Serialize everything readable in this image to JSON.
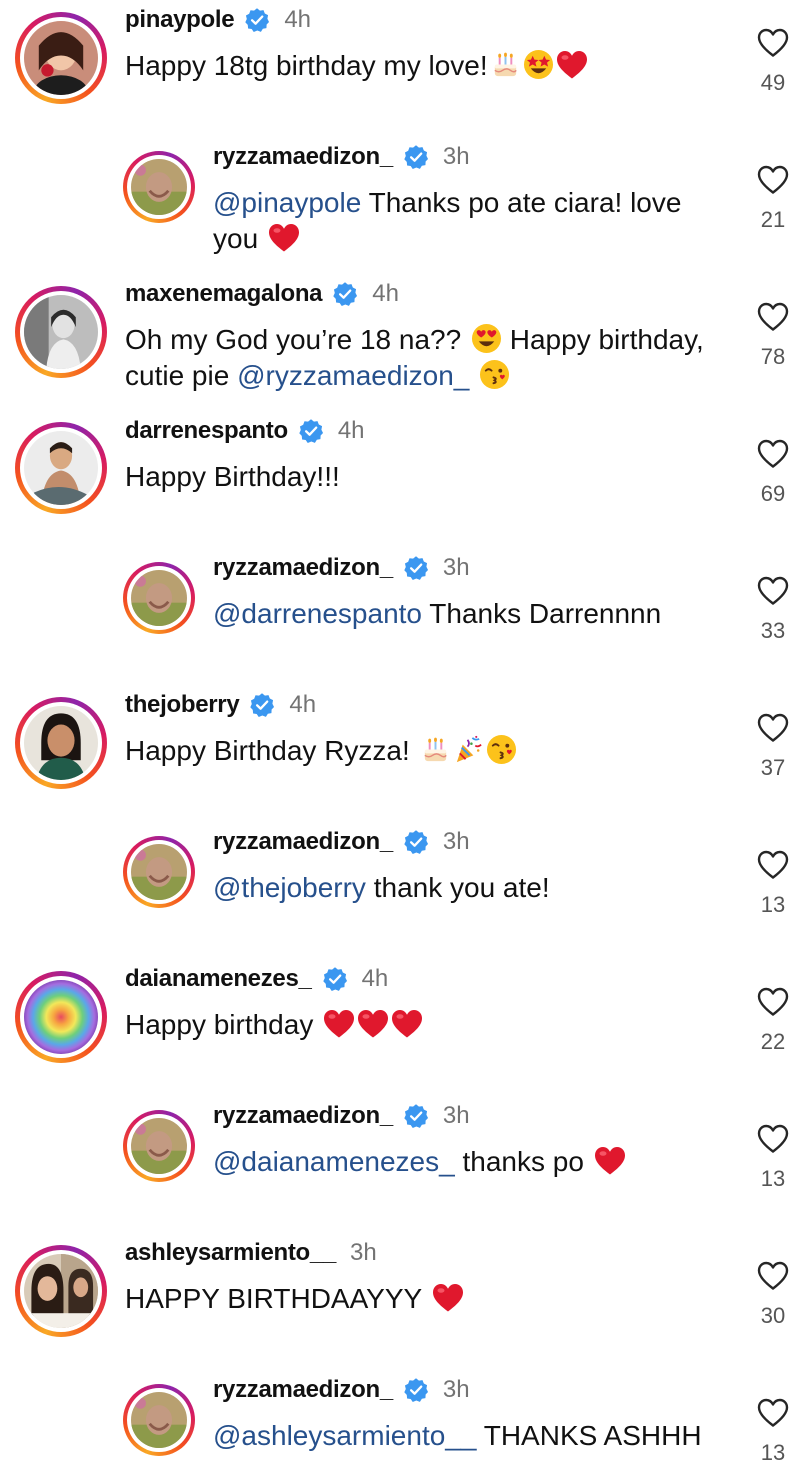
{
  "colors": {
    "mention": "#26508c",
    "verified": "#3b97f0",
    "heart": "#e0182d",
    "timestamp": "#737373"
  },
  "comments": [
    {
      "user": "pinaypole",
      "time": "4h",
      "text": "Happy 18tg birthday my love!",
      "likes": "49"
    },
    {
      "user": "ryzzamaedizon_",
      "time": "3h",
      "mention": "@pinaypole",
      "text": "Thanks po ate ciara! love",
      "text2": "you",
      "likes": "21"
    },
    {
      "user": "maxenemagalona",
      "time": "4h",
      "text": "Oh my God you’re 18 na??",
      "text_b": "Happy birthday,",
      "text2": "cutie pie",
      "mention2": "@ryzzamaedizon_",
      "likes": "78"
    },
    {
      "user": "darrenespanto",
      "time": "4h",
      "text": "Happy Birthday!!!",
      "likes": "69"
    },
    {
      "user": "ryzzamaedizon_",
      "time": "3h",
      "mention": "@darrenespanto",
      "text": "Thanks Darrennnn",
      "likes": "33"
    },
    {
      "user": "thejoberry",
      "time": "4h",
      "text": "Happy Birthday Ryzza!",
      "likes": "37"
    },
    {
      "user": "ryzzamaedizon_",
      "time": "3h",
      "mention": "@thejoberry",
      "text": "thank you ate!",
      "likes": "13"
    },
    {
      "user": "daianamenezes_",
      "time": "4h",
      "text": "Happy birthday",
      "likes": "22"
    },
    {
      "user": "ryzzamaedizon_",
      "time": "3h",
      "mention": "@daianamenezes_",
      "text": "thanks po",
      "likes": "13"
    },
    {
      "user": "ashleysarmiento__",
      "time": "3h",
      "text": "HAPPY BIRTHDAAYYY",
      "likes": "30"
    },
    {
      "user": "ryzzamaedizon_",
      "time": "3h",
      "mention": "@ashleysarmiento__",
      "text": "THANKS ASHHH",
      "likes": "13"
    }
  ]
}
